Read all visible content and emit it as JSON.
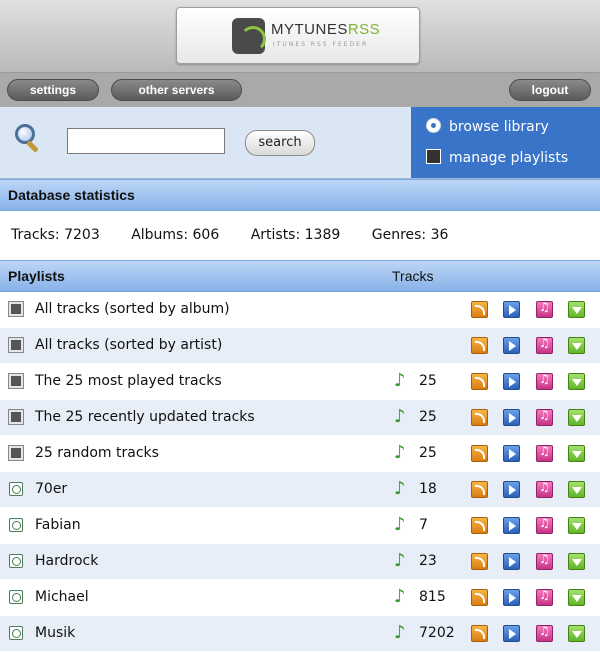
{
  "header": {
    "logo_title_main": "MYTUNES",
    "logo_title_accent": "RSS",
    "logo_subtitle": "ITUNES RSS FEEDER"
  },
  "nav": {
    "settings": "settings",
    "other_servers": "other servers",
    "logout": "logout"
  },
  "search": {
    "input_value": "",
    "button_label": "search"
  },
  "right_nav": {
    "browse_library": "browse library",
    "manage_playlists": "manage playlists"
  },
  "database_stats": {
    "title": "Database statistics",
    "tracks": "Tracks: 7203",
    "albums": "Albums: 606",
    "artists": "Artists: 1389",
    "genres": "Genres: 36"
  },
  "playlists": {
    "title": "Playlists",
    "tracks_header": "Tracks",
    "items": [
      {
        "name": "All tracks (sorted by album)",
        "count": "",
        "kind": "smart"
      },
      {
        "name": "All tracks (sorted by artist)",
        "count": "",
        "kind": "smart"
      },
      {
        "name": "The 25 most played tracks",
        "count": "25",
        "kind": "smart"
      },
      {
        "name": "The 25 recently updated tracks",
        "count": "25",
        "kind": "smart"
      },
      {
        "name": "25 random tracks",
        "count": "25",
        "kind": "smart"
      },
      {
        "name": "70er",
        "count": "18",
        "kind": "regular"
      },
      {
        "name": "Fabian",
        "count": "7",
        "kind": "regular"
      },
      {
        "name": "Hardrock",
        "count": "23",
        "kind": "regular"
      },
      {
        "name": "Michael",
        "count": "815",
        "kind": "regular"
      },
      {
        "name": "Musik",
        "count": "7202",
        "kind": "regular"
      }
    ]
  },
  "icons": {
    "search": "magnifier-icon",
    "browse": "radio-icon",
    "manage": "playlist-icon",
    "track_note": "music-note-icon",
    "actions": [
      "rss-feed-icon",
      "play-icon",
      "itunes-music-icon",
      "download-icon"
    ]
  },
  "colors": {
    "header_blue": "#88b2e8",
    "nav_blue": "#3a74c8",
    "row_alt": "#e7eef7",
    "rss_orange": "#d97d12",
    "play_blue": "#2c62b8",
    "music_pink": "#c93488",
    "download_green": "#64b42b"
  }
}
